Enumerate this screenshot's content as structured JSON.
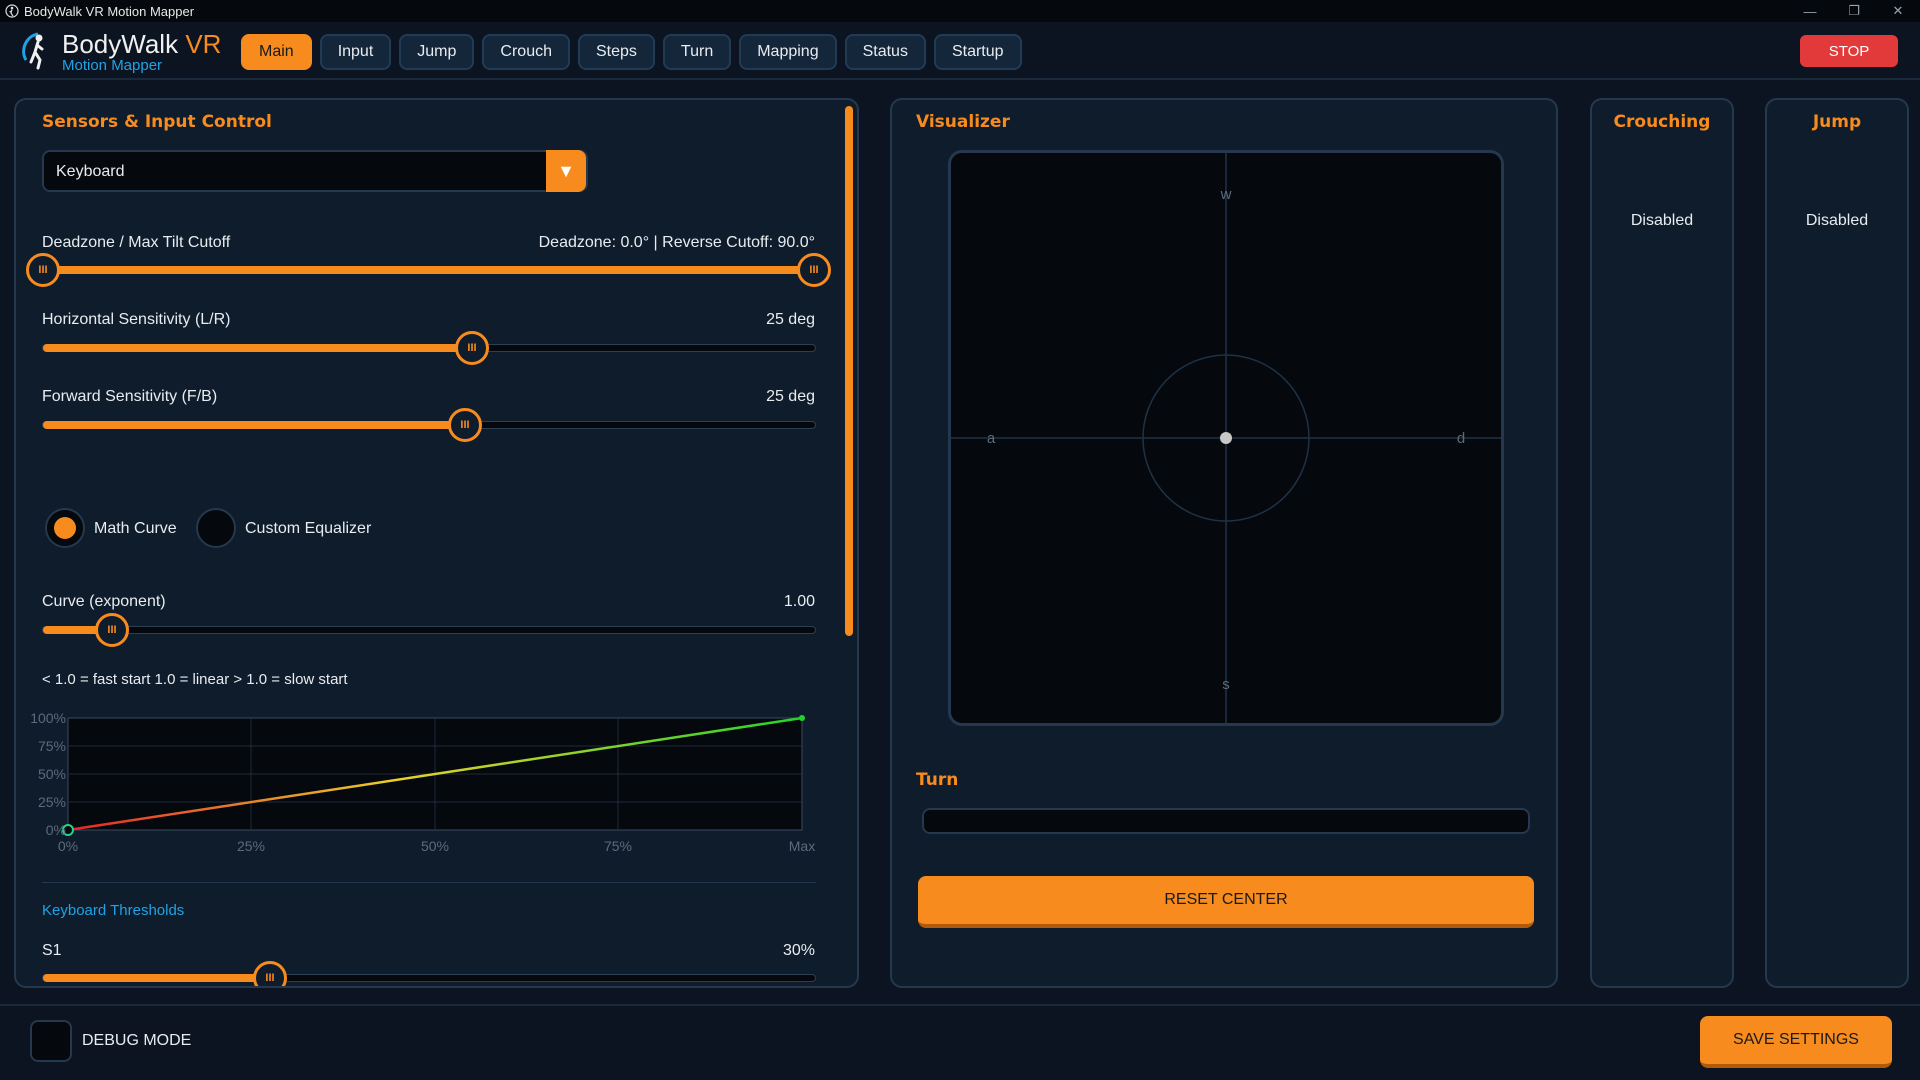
{
  "window": {
    "title": "BodyWalk VR Motion Mapper"
  },
  "brand": {
    "name": "BodyWalk",
    "suffix": "VR",
    "subtitle": "Motion Mapper"
  },
  "tabs": [
    {
      "label": "Main",
      "active": true
    },
    {
      "label": "Input"
    },
    {
      "label": "Jump"
    },
    {
      "label": "Crouch"
    },
    {
      "label": "Steps"
    },
    {
      "label": "Turn"
    },
    {
      "label": "Mapping"
    },
    {
      "label": "Status"
    },
    {
      "label": "Startup"
    }
  ],
  "stop_label": "STOP",
  "sensors": {
    "title": "Sensors & Input Control",
    "input_select": "Keyboard",
    "deadzone": {
      "label": "Deadzone / Max Tilt Cutoff",
      "readout": "Deadzone: 0.0°  |  Reverse Cutoff: 90.0°",
      "low": 0.0,
      "high": 90.0
    },
    "horizontal": {
      "label": "Horizontal Sensitivity (L/R)",
      "value_text": "25 deg",
      "fraction": 0.555
    },
    "forward": {
      "label": "Forward Sensitivity (F/B)",
      "value_text": "25 deg",
      "fraction": 0.546
    },
    "mode_options": [
      {
        "label": "Math Curve",
        "selected": true
      },
      {
        "label": "Custom Equalizer",
        "selected": false
      }
    ],
    "curve": {
      "label": "Curve (exponent)",
      "value_text": "1.00",
      "fraction": 0.09
    },
    "curve_hint": "< 1.0 = fast start   1.0 = linear   > 1.0 = slow start",
    "graph": {
      "y_ticks": [
        "100%",
        "75%",
        "50%",
        "25%",
        "0%"
      ],
      "x_ticks": [
        "0%",
        "25%",
        "50%",
        "75%",
        "Max"
      ]
    },
    "thresholds_title": "Keyboard Thresholds",
    "s1": {
      "label": "S1",
      "value_text": "30%",
      "fraction": 0.295
    }
  },
  "visualizer": {
    "title": "Visualizer",
    "labels": {
      "up": "w",
      "down": "s",
      "left": "a",
      "right": "d"
    },
    "turn_title": "Turn",
    "reset_label": "RESET CENTER"
  },
  "crouching": {
    "title": "Crouching",
    "status": "Disabled"
  },
  "jump": {
    "title": "Jump",
    "status": "Disabled"
  },
  "footer": {
    "debug_label": "DEBUG MODE",
    "save_label": "SAVE SETTINGS"
  },
  "colors": {
    "accent": "#f78b1e",
    "link": "#1fa3e6",
    "stop": "#e23a3a",
    "panel": "#0f1c2b"
  }
}
